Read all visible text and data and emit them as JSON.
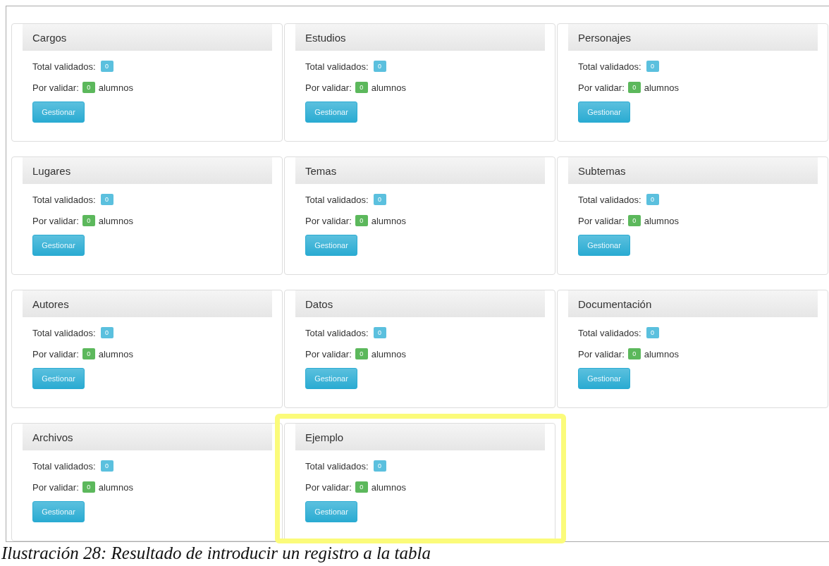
{
  "cards": [
    {
      "title": "Cargos",
      "total_label": "Total validados:",
      "total": "0",
      "pending_label": "Por validar:",
      "pending": "0",
      "pending_unit": "alumnos",
      "button": "Gestionar",
      "highlighted": false
    },
    {
      "title": "Estudios",
      "total_label": "Total validados:",
      "total": "0",
      "pending_label": "Por validar:",
      "pending": "0",
      "pending_unit": "alumnos",
      "button": "Gestionar",
      "highlighted": false
    },
    {
      "title": "Personajes",
      "total_label": "Total validados:",
      "total": "0",
      "pending_label": "Por validar:",
      "pending": "0",
      "pending_unit": "alumnos",
      "button": "Gestionar",
      "highlighted": false
    },
    {
      "title": "Lugares",
      "total_label": "Total validados:",
      "total": "0",
      "pending_label": "Por validar:",
      "pending": "0",
      "pending_unit": "alumnos",
      "button": "Gestionar",
      "highlighted": false
    },
    {
      "title": "Temas",
      "total_label": "Total validados:",
      "total": "0",
      "pending_label": "Por validar:",
      "pending": "0",
      "pending_unit": "alumnos",
      "button": "Gestionar",
      "highlighted": false
    },
    {
      "title": "Subtemas",
      "total_label": "Total validados:",
      "total": "0",
      "pending_label": "Por validar:",
      "pending": "0",
      "pending_unit": "alumnos",
      "button": "Gestionar",
      "highlighted": false
    },
    {
      "title": "Autores",
      "total_label": "Total validados:",
      "total": "0",
      "pending_label": "Por validar:",
      "pending": "0",
      "pending_unit": "alumnos",
      "button": "Gestionar",
      "highlighted": false
    },
    {
      "title": "Datos",
      "total_label": "Total validados:",
      "total": "0",
      "pending_label": "Por validar:",
      "pending": "0",
      "pending_unit": "alumnos",
      "button": "Gestionar",
      "highlighted": false
    },
    {
      "title": "Documentación",
      "total_label": "Total validados:",
      "total": "0",
      "pending_label": "Por validar:",
      "pending": "0",
      "pending_unit": "alumnos",
      "button": "Gestionar",
      "highlighted": false
    },
    {
      "title": "Archivos",
      "total_label": "Total validados:",
      "total": "0",
      "pending_label": "Por validar:",
      "pending": "0",
      "pending_unit": "alumnos",
      "button": "Gestionar",
      "highlighted": false
    },
    {
      "title": "Ejemplo",
      "total_label": "Total validados:",
      "total": "0",
      "pending_label": "Por validar:",
      "pending": "0",
      "pending_unit": "alumnos",
      "button": "Gestionar",
      "highlighted": true
    }
  ],
  "caption": "Ilustración 28: Resultado de introducir un registro a la tabla"
}
